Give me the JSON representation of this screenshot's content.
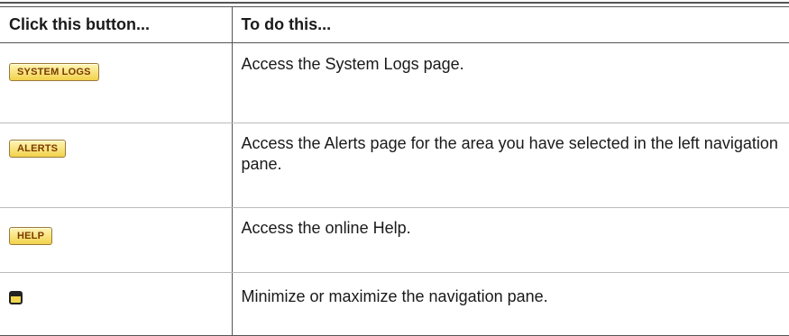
{
  "table": {
    "headers": [
      "Click this button...",
      "To do this..."
    ],
    "rows": [
      {
        "button_label": "SYSTEM LOGS",
        "button_icon": "",
        "description": "Access the System Logs page."
      },
      {
        "button_label": "ALERTS",
        "button_icon": "",
        "description": "Access the Alerts page for the area you have selected in the left navigation pane."
      },
      {
        "button_label": "HELP",
        "button_icon": "",
        "description": "Access the online Help."
      },
      {
        "button_label": "",
        "button_icon": "minimize-maximize-window-icon",
        "description": "Minimize or maximize the navigation pane."
      }
    ]
  },
  "colors": {
    "button_fill": "#f2d24a",
    "button_text": "#7a3b00",
    "rule": "#555555"
  }
}
